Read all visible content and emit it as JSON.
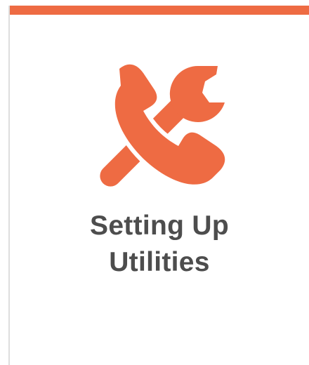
{
  "card": {
    "icon": "phone-and-wrench-icon",
    "title_lines": [
      "Setting Up",
      "Utilities"
    ]
  },
  "colors": {
    "accent": "#ee6b43",
    "title_text": "#4d4d4d",
    "card_border": "#dedede"
  }
}
